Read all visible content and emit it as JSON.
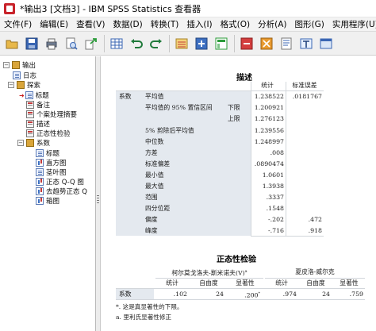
{
  "window": {
    "title": "*输出3 [文档3] - IBM SPSS Statistics 查看器"
  },
  "menu": {
    "items": [
      "文件(F)",
      "编辑(E)",
      "查看(V)",
      "数据(D)",
      "转换(T)",
      "插入(I)",
      "格式(O)",
      "分析(A)",
      "图形(G)",
      "实用程序(U)",
      "扩"
    ]
  },
  "toolbar": {
    "buttons": [
      "open-icon",
      "save-icon",
      "print-icon",
      "print-preview-icon",
      "export-icon",
      "goto-data-icon",
      "undo-icon",
      "redo-icon",
      "goto-case-icon",
      "insert-output-icon",
      "pivot-icon",
      "show-all-icon",
      "hide-icon",
      "insert-heading-icon",
      "insert-text-icon",
      "designate-window-icon"
    ]
  },
  "nav": {
    "root": "输出",
    "log": "日志",
    "explore": "探索",
    "title": "标题",
    "notes": "备注",
    "case_summary": "个案处理摘要",
    "descriptives": "描述",
    "normality": "正态性检验",
    "coeff": "系数",
    "coeff_title": "标题",
    "histogram": "直方图",
    "stemleaf": "茎叶图",
    "qq": "正态 Q-Q 图",
    "detrended": "去趋势正态 Q",
    "boxplot": "箱图"
  },
  "descriptives": {
    "title": "描述",
    "col_stat": "统计",
    "col_se": "标准误差",
    "row_group": "系数",
    "mean_label": "平均值",
    "ci_label": "平均值的 95% 置信区间",
    "lower_label": "下限",
    "upper_label": "上限",
    "trim_label": "5% 剪除后平均值",
    "median_label": "中位数",
    "var_label": "方差",
    "sd_label": "标准偏差",
    "min_label": "最小值",
    "max_label": "最大值",
    "range_label": "范围",
    "iqr_label": "四分位距",
    "skew_label": "偏度",
    "kurt_label": "峰度",
    "mean": "1.238522",
    "mean_se": ".0181767",
    "lower": "1.200921",
    "upper": "1.276123",
    "trim": "1.239556",
    "median": "1.248997",
    "var": ".008",
    "sd": ".0890474",
    "min": "1.0601",
    "max": "1.3938",
    "range": ".3337",
    "iqr": ".1548",
    "skew": "-.202",
    "skew_se": ".472",
    "kurt": "-.716",
    "kurt_se": ".918"
  },
  "normality": {
    "title": "正态性检验",
    "ks_header": "柯尔莫戈洛夫-斯米诺夫(V)",
    "ks_sup": "a",
    "sw_header": "夏皮洛-威尔克",
    "stat": "统计",
    "df": "自由度",
    "sig": "显著性",
    "row": "系数",
    "ks_stat": ".102",
    "ks_df": "24",
    "ks_sig": ".200",
    "ks_sig_mark": "*",
    "sw_stat": ".974",
    "sw_df": "24",
    "sw_sig": ".759",
    "note1": "*. 这是真显著性的下限。",
    "note2": "a. 里利氏显著性修正"
  }
}
